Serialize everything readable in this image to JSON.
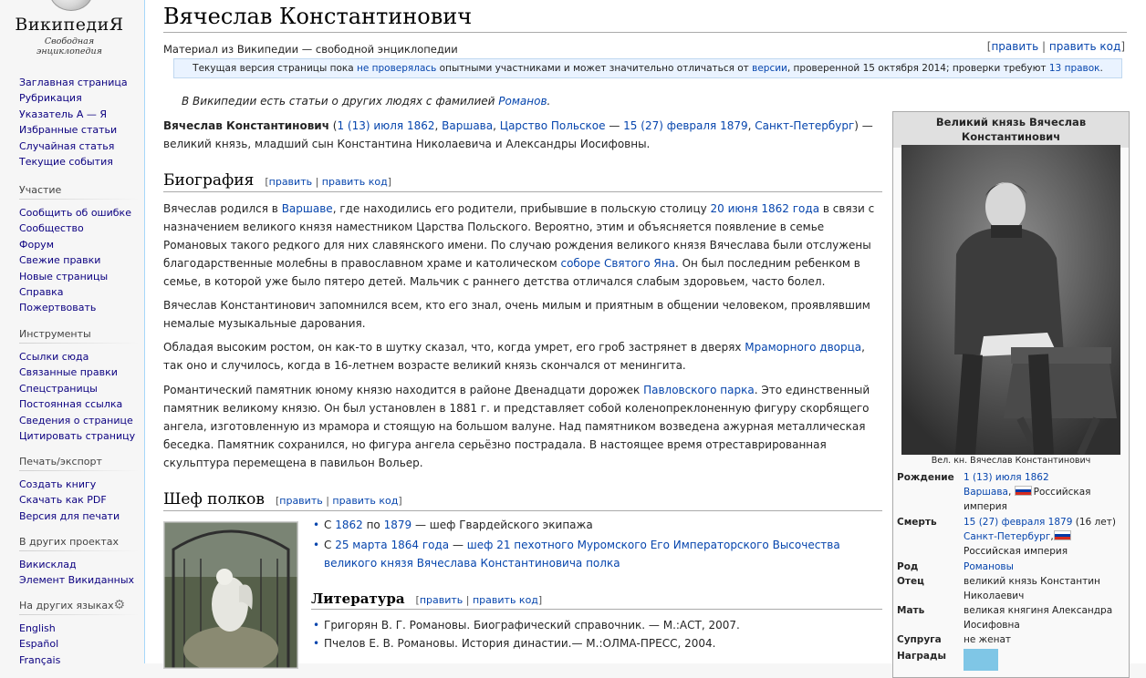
{
  "logo": {
    "wordmark": "ВикипедиЯ",
    "tagline": "Свободная энциклопедия"
  },
  "sidebar": {
    "main": [
      "Заглавная страница",
      "Рубрикация",
      "Указатель А — Я",
      "Избранные статьи",
      "Случайная статья",
      "Текущие события"
    ],
    "participation": {
      "title": "Участие",
      "items": [
        "Сообщить об ошибке",
        "Сообщество",
        "Форум",
        "Свежие правки",
        "Новые страницы",
        "Справка",
        "Пожертвовать"
      ]
    },
    "tools": {
      "title": "Инструменты",
      "items": [
        "Ссылки сюда",
        "Связанные правки",
        "Спецстраницы",
        "Постоянная ссылка",
        "Сведения о странице",
        "Цитировать страницу"
      ]
    },
    "print": {
      "title": "Печать/экспорт",
      "items": [
        "Создать книгу",
        "Скачать как PDF",
        "Версия для печати"
      ]
    },
    "projects": {
      "title": "В других проектах",
      "items": [
        "Викисклад",
        "Элемент Викиданных"
      ]
    },
    "languages": {
      "title": "На других языках",
      "items": [
        "English",
        "Español",
        "Français"
      ]
    }
  },
  "article": {
    "title": "Вячеслав Константинович",
    "site_sub": "Материал из Википедии — свободной энциклопедии",
    "edit": "править",
    "edit_code": "править код",
    "flagged": {
      "t1": "Текущая версия страницы пока ",
      "l1": "не проверялась",
      "t2": " опытными участниками и может значительно отличаться от ",
      "l2": "версии",
      "t3": ", проверенной 15 октября 2014; проверки требуют ",
      "l3": "13 правок",
      "t4": "."
    },
    "hatnote": {
      "text": "В Википедии есть статьи о других людях с фамилией ",
      "link": "Романов",
      "end": "."
    },
    "lead": {
      "name": "Вячеслав Константинович",
      "t1": " (",
      "l1": "1 (13) июля 1862",
      "t2": ", ",
      "l2": "Варшава",
      "t3": ", ",
      "l3": "Царство Польское",
      "t4": " — ",
      "l4": "15 (27) февраля 1879",
      "t5": ", ",
      "l5": "Санкт-Петербург",
      "t6": ") — великий князь, младший сын Константина Николаевича и Александры Иосифовны."
    },
    "bio": {
      "heading": "Биография",
      "p1": {
        "t1": "Вячеслав родился в ",
        "l1": "Варшаве",
        "t2": ", где находились его родители, прибывшие в польскую столицу ",
        "l2": "20 июня 1862 года",
        "t3": " в связи с назначением великого князя наместником Царства Польского. Вероятно, этим и объясняется появление в семье Романовых такого редкого для них славянского имени. По случаю рождения великого князя Вячеслава были отслужены благодарственные молебны в православном храме и католическом ",
        "l3": "соборе Святого Яна",
        "t4": ". Он был последним ребенком в семье, в которой уже было пятеро детей. Мальчик с раннего детства отличался слабым здоровьем, часто болел."
      },
      "p2": "Вячеслав Константинович запомнился всем, кто его знал, очень милым и приятным в общении человеком, проявлявшим немалые музыкальные дарования.",
      "p3": {
        "t1": "Обладая высоким ростом, он как-то в шутку сказал, что, когда умрет, его гроб застрянет в дверях ",
        "l1": "Мраморного дворца",
        "t2": ", так оно и случилось, когда в 16-летнем возрасте великий князь скончался от менингита."
      },
      "p4": {
        "t1": "Романтический памятник юному князю находится в районе Двенадцати дорожек ",
        "l1": "Павловского парка",
        "t2": ". Это единственный памятник великому князю. Он был установлен в 1881 г. и представляет собой коленопреклоненную фигуру скорбящего ангела, изготовленную из мрамора и стоящую на большом валуне. Над памятником возведена ажурная металлическая беседка. Памятник сохранился, но фигура ангела серьёзно пострадала. В настоящее время отреставрированная скульптура перемещена в павильон Вольер."
      }
    },
    "chief": {
      "heading": "Шеф полков",
      "i1": {
        "t1": "С ",
        "l1": "1862",
        "t2": " по ",
        "l2": "1879",
        "t3": " — шеф Гвардейского экипажа"
      },
      "i2": {
        "t1": "С ",
        "l1": "25 марта 1864 года",
        "t2": " — ",
        "l2": "шеф 21 пехотного Муромского Его Императорского Высочества великого князя Вячеслава Константиновича полка"
      }
    },
    "lit": {
      "heading": "Литература",
      "items": [
        "Григорян В. Г. Романовы. Биографический справочник. — М.:АСТ, 2007.",
        "Пчелов Е. В. Романовы. История династии.— М.:ОЛМА-ПРЕСС, 2004."
      ]
    }
  },
  "infobox": {
    "title": "Великий князь Вячеслав Константинович",
    "caption": "Вел. кн. Вячеслав Константинович",
    "birth": {
      "label": "Рождение",
      "date": "1 (13) июля 1862",
      "place": "Варшава",
      "country": "Российская империя"
    },
    "death": {
      "label": "Смерть",
      "date": "15 (27) февраля 1879",
      "age": " (16 лет)",
      "place": "Санкт-Петербург",
      "country": "Российская империя"
    },
    "dynasty": {
      "label": "Род",
      "value": "Романовы"
    },
    "father": {
      "label": "Отец",
      "value": "великий князь Константин Николаевич"
    },
    "mother": {
      "label": "Мать",
      "value": "великая княгиня Александра Иосифовна"
    },
    "spouse": {
      "label": "Супруга",
      "value": "не женат"
    },
    "awards": {
      "label": "Награды"
    }
  },
  "colors": {
    "link": "#0645ad",
    "visited_nav": "#0b0080",
    "infobox_header": "#e0e0e0",
    "flagged_bg": "#eaf3ff"
  }
}
